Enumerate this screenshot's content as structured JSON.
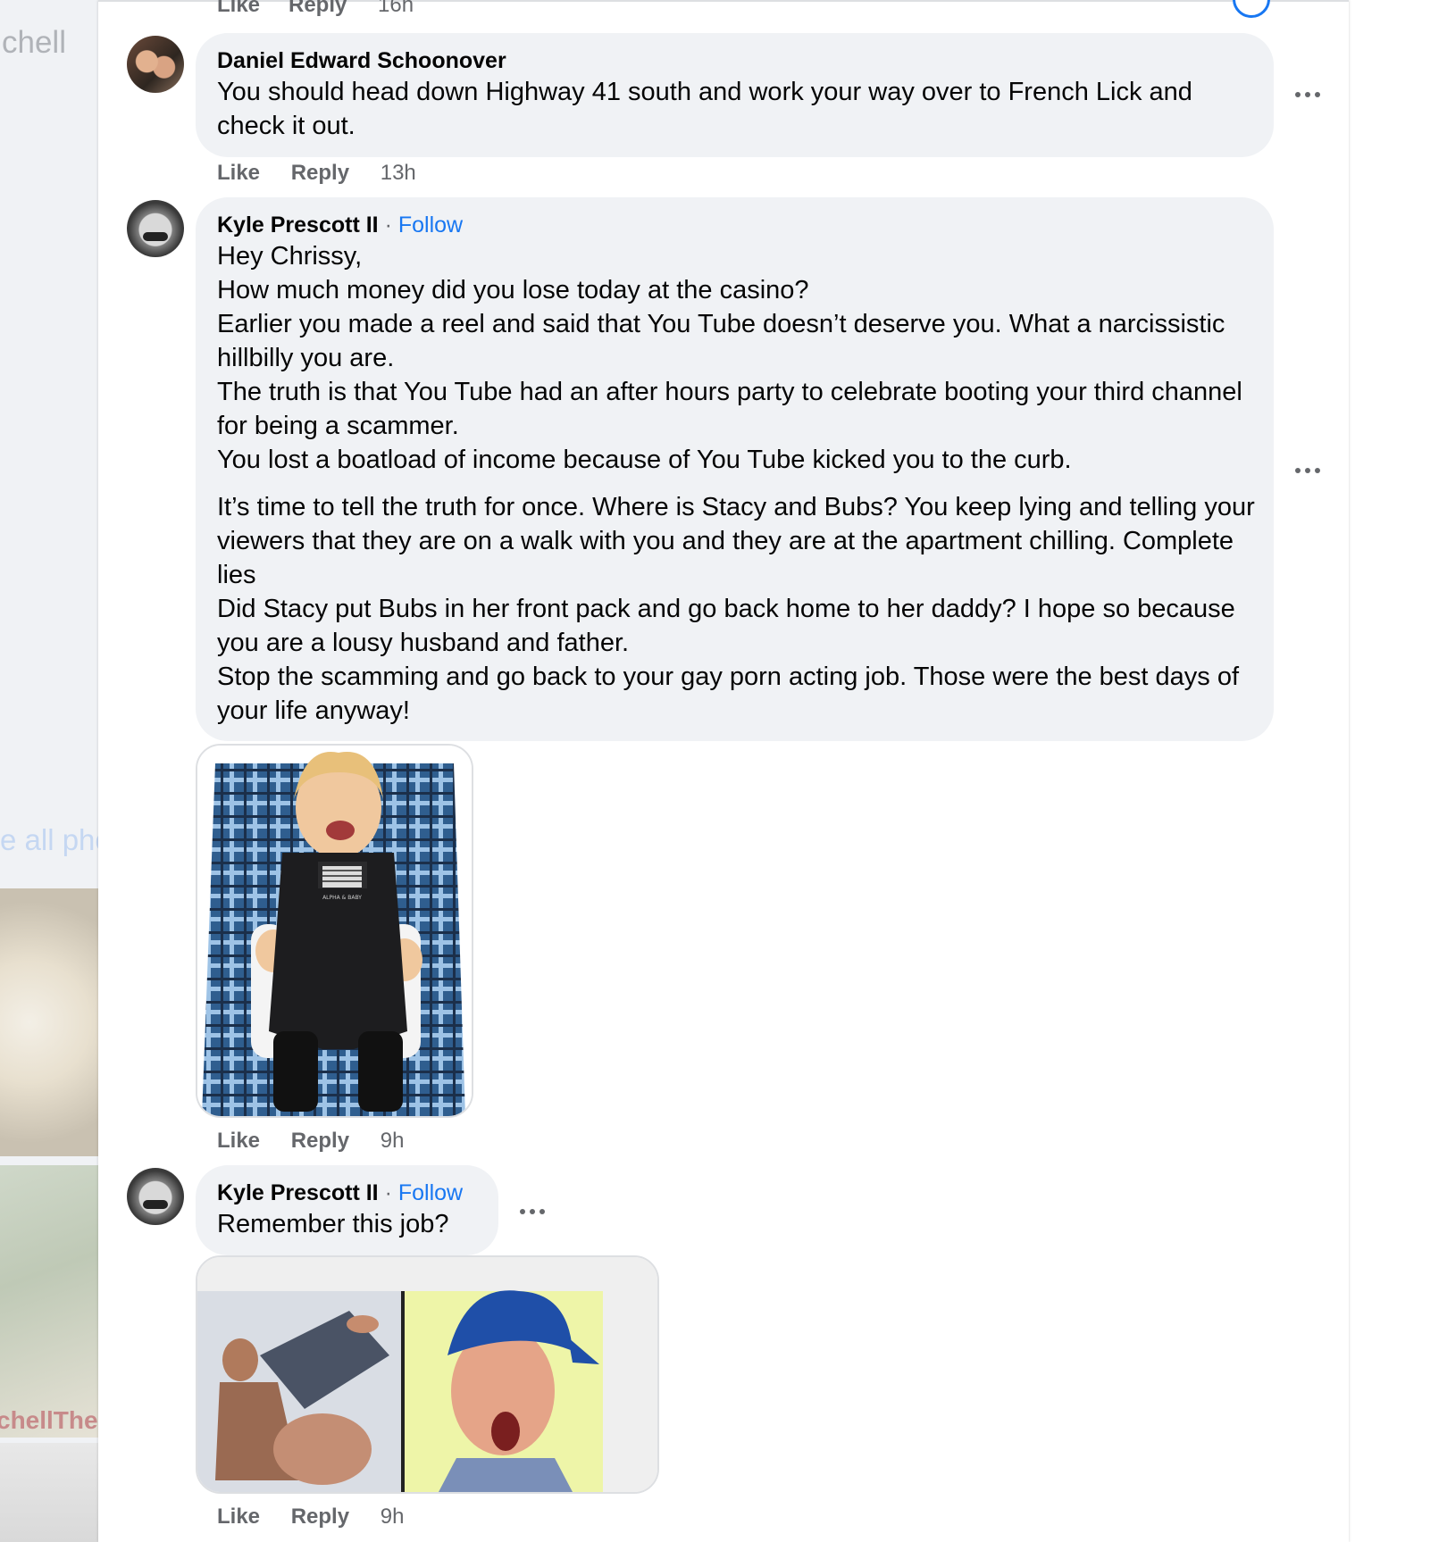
{
  "background": {
    "name_fragment": "chell",
    "see_all_fragment": "e all pho",
    "watermark_fragment": "chellThe"
  },
  "top_partial": {
    "like": "Like",
    "reply": "Reply",
    "time": "16h"
  },
  "comments": [
    {
      "author": "Daniel Edward Schoonover",
      "lines": [
        "You should head down Highway 41 south and work your way over to French Lick and check it out."
      ],
      "like": "Like",
      "reply": "Reply",
      "time": "13h"
    },
    {
      "author": "Kyle Prescott II",
      "separator": "·",
      "follow": "Follow",
      "lines": [
        "Hey Chrissy,",
        "How much money did you lose today at the casino?",
        "Earlier you made a reel and said that You Tube doesn’t deserve you. What a narcissistic hillbilly you are.",
        "The truth is that You Tube had an after hours party to celebrate booting your third channel for being a scammer.",
        "You lost a boatload of income because of You Tube kicked you to the curb.",
        "It’s time to tell the truth for once. Where is Stacy and Bubs? You keep lying and telling your viewers that they are on a walk with you and they are at the apartment chilling. Complete lies",
        "Did Stacy put Bubs in her front pack and go back home to her daddy? I hope so because you are a lousy husband and father.",
        "Stop the scamming and go back to your gay porn acting job. Those were the best days of your life anyway!"
      ],
      "attachment_flag_text": "ALPHA & BABY",
      "like": "Like",
      "reply": "Reply",
      "time": "9h"
    },
    {
      "author": "Kyle Prescott II",
      "separator": "·",
      "follow": "Follow",
      "lines": [
        "Remember this job?"
      ],
      "like": "Like",
      "reply": "Reply",
      "time": "9h"
    }
  ],
  "icons": {
    "more": "more-horizontal-icon",
    "avatar": "profile-avatar"
  },
  "colors": {
    "link": "#1877f2",
    "bubble": "#f0f2f5",
    "secondary_text": "#65676b"
  }
}
